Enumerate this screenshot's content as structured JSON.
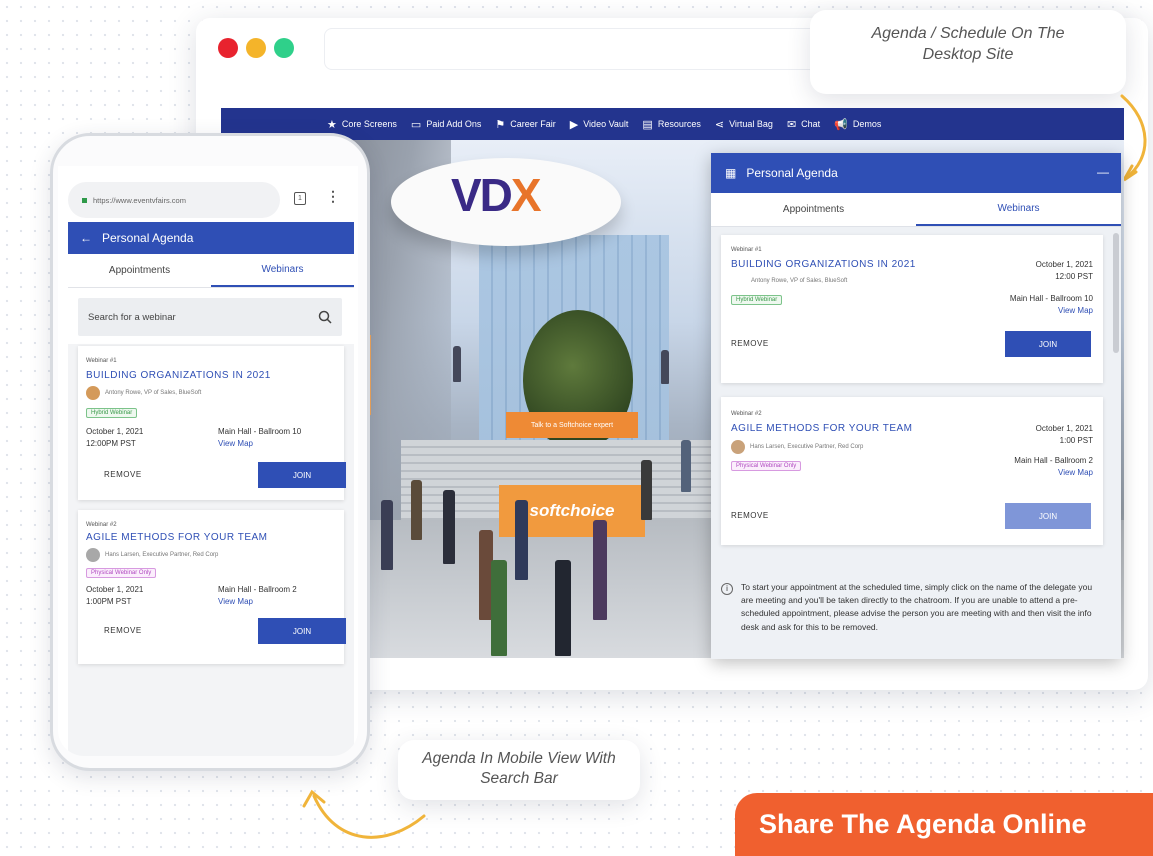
{
  "captions": {
    "desktop": "Agenda / Schedule On The Desktop Site",
    "mobile": "Agenda In Mobile View With Search Bar",
    "banner": "Share The Agenda Online"
  },
  "colors": {
    "brand_blue": "#2f4fb5",
    "nav_blue": "#23348e",
    "banner_orange": "#f0602f",
    "accent_yellow": "#f0b43a"
  },
  "desktop": {
    "nav": [
      {
        "icon": "star-icon",
        "label": "Core Screens"
      },
      {
        "icon": "card-icon",
        "label": "Paid Add Ons"
      },
      {
        "icon": "flag-icon",
        "label": "Career Fair"
      },
      {
        "icon": "video-icon",
        "label": "Video Vault"
      },
      {
        "icon": "document-icon",
        "label": "Resources"
      },
      {
        "icon": "share-icon",
        "label": "Virtual Bag"
      },
      {
        "icon": "chat-icon",
        "label": "Chat"
      },
      {
        "icon": "megaphone-icon",
        "label": "Demos"
      }
    ],
    "scene": {
      "logo_main": "VD",
      "logo_accent": "X",
      "sign": "Talk to a Softchoice expert",
      "booth": "softchoice"
    },
    "agenda": {
      "title": "Personal Agenda",
      "collapse": "—",
      "tabs": [
        "Appointments",
        "Webinars"
      ],
      "active_tab": "Webinars",
      "webinars": [
        {
          "label": "Webinar #1",
          "title": "BUILDING ORGANIZATIONS IN 2021",
          "speaker": "Antony Rowe, VP of Sales, BlueSoft",
          "tag": "Hybrid Webinar",
          "date": "October 1, 2021",
          "time": "12:00 PST",
          "room": "Main Hall - Ballroom 10",
          "map": "View Map",
          "remove": "REMOVE",
          "join": "JOIN"
        },
        {
          "label": "Webinar #2",
          "title": "AGILE METHODS FOR YOUR TEAM",
          "speaker": "Hans Larsen, Executive Partner, Red Corp",
          "tag": "Physical Webinar Only",
          "date": "October 1, 2021",
          "time": "1:00 PST",
          "room": "Main Hall - Ballroom 2",
          "map": "View Map",
          "remove": "REMOVE",
          "join": "JOIN"
        }
      ],
      "info": "To start your appointment at the scheduled time, simply click on the name of the delegate you are meeting and you'll be taken directly to the chatroom. If you are unable to attend a pre-scheduled appointment, please advise the person you are meeting with and then visit the info desk and ask for this to be removed."
    }
  },
  "mobile": {
    "url": "https://www.eventvfairs.com",
    "tab_count": "1",
    "more": "⋮",
    "back": "←",
    "title": "Personal Agenda",
    "tabs": [
      "Appointments",
      "Webinars"
    ],
    "active_tab": "Webinars",
    "search_placeholder": "Search for a webinar",
    "webinars": [
      {
        "label": "Webinar #1",
        "title": "BUILDING ORGANIZATIONS IN 2021",
        "speaker": "Antony Rowe, VP of Sales, BlueSoft",
        "tag": "Hybrid Webinar",
        "date": "October 1, 2021",
        "time": "12:00PM PST",
        "room": "Main Hall - Ballroom 10",
        "map": "View Map",
        "remove": "REMOVE",
        "join": "JOIN"
      },
      {
        "label": "Webinar #2",
        "title": "AGILE METHODS FOR YOUR TEAM",
        "speaker": "Hans Larsen, Executive Partner, Red Corp",
        "tag": "Physical Webinar Only",
        "date": "October 1, 2021",
        "time": "1:00PM PST",
        "room": "Main Hall - Ballroom 2",
        "map": "View Map",
        "remove": "REMOVE",
        "join": "JOIN"
      }
    ]
  }
}
